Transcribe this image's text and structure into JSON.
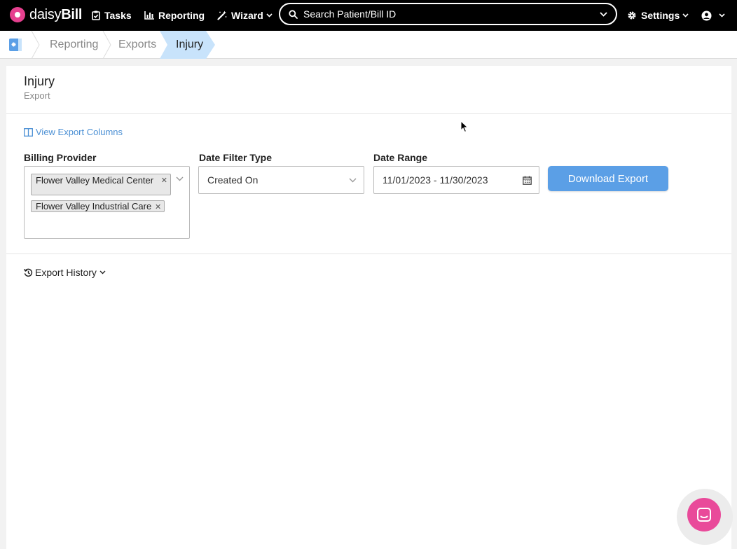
{
  "app": {
    "brand_prefix": "daisy",
    "brand_suffix": "Bill"
  },
  "topnav": {
    "tasks": "Tasks",
    "reporting": "Reporting",
    "wizard": "Wizard",
    "search_placeholder": "Search Patient/Bill ID",
    "settings": "Settings"
  },
  "breadcrumb": {
    "items": [
      "Reporting",
      "Exports"
    ],
    "active": "Injury"
  },
  "page": {
    "title": "Injury",
    "subtitle": "Export",
    "view_columns_link": "View Export Columns",
    "billing_provider_label": "Billing Provider",
    "billing_providers_selected": [
      "Flower Valley Medical Center",
      "Flower Valley Industrial Care"
    ],
    "date_filter_type_label": "Date Filter Type",
    "date_filter_type_value": "Created On",
    "date_range_label": "Date Range",
    "date_range_value": "11/01/2023 - 11/30/2023",
    "download_button": "Download Export",
    "export_history": "Export History"
  },
  "colors": {
    "brand_pink": "#e6408f",
    "link_blue": "#4a8fd4",
    "button_blue": "#5b9fe6",
    "active_crumb": "#c8e3fb"
  },
  "icons": [
    "flower-logo-icon",
    "clipboard-icon",
    "bar-chart-icon",
    "wand-icon",
    "search-icon",
    "chevron-down-icon",
    "gear-icon",
    "user-circle-icon",
    "app-home-icon",
    "columns-icon",
    "calendar-icon",
    "history-icon",
    "chat-icon"
  ]
}
